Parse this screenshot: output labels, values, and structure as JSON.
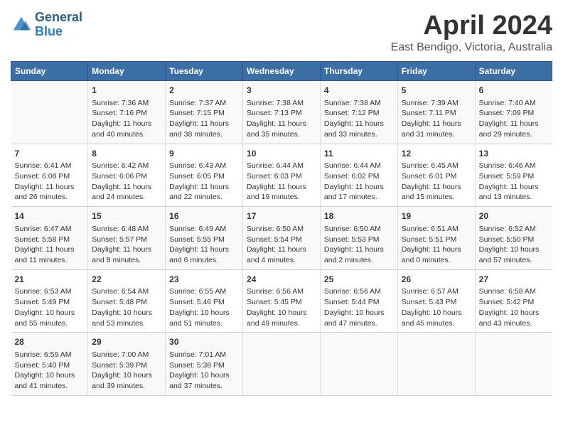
{
  "header": {
    "logo_line1": "General",
    "logo_line2": "Blue",
    "title": "April 2024",
    "subtitle": "East Bendigo, Victoria, Australia"
  },
  "columns": [
    "Sunday",
    "Monday",
    "Tuesday",
    "Wednesday",
    "Thursday",
    "Friday",
    "Saturday"
  ],
  "weeks": [
    {
      "cells": [
        {
          "day": "",
          "info": ""
        },
        {
          "day": "1",
          "info": "Sunrise: 7:36 AM\nSunset: 7:16 PM\nDaylight: 11 hours\nand 40 minutes."
        },
        {
          "day": "2",
          "info": "Sunrise: 7:37 AM\nSunset: 7:15 PM\nDaylight: 11 hours\nand 38 minutes."
        },
        {
          "day": "3",
          "info": "Sunrise: 7:38 AM\nSunset: 7:13 PM\nDaylight: 11 hours\nand 35 minutes."
        },
        {
          "day": "4",
          "info": "Sunrise: 7:38 AM\nSunset: 7:12 PM\nDaylight: 11 hours\nand 33 minutes."
        },
        {
          "day": "5",
          "info": "Sunrise: 7:39 AM\nSunset: 7:11 PM\nDaylight: 11 hours\nand 31 minutes."
        },
        {
          "day": "6",
          "info": "Sunrise: 7:40 AM\nSunset: 7:09 PM\nDaylight: 11 hours\nand 29 minutes."
        }
      ]
    },
    {
      "cells": [
        {
          "day": "7",
          "info": "Sunrise: 6:41 AM\nSunset: 6:08 PM\nDaylight: 11 hours\nand 26 minutes."
        },
        {
          "day": "8",
          "info": "Sunrise: 6:42 AM\nSunset: 6:06 PM\nDaylight: 11 hours\nand 24 minutes."
        },
        {
          "day": "9",
          "info": "Sunrise: 6:43 AM\nSunset: 6:05 PM\nDaylight: 11 hours\nand 22 minutes."
        },
        {
          "day": "10",
          "info": "Sunrise: 6:44 AM\nSunset: 6:03 PM\nDaylight: 11 hours\nand 19 minutes."
        },
        {
          "day": "11",
          "info": "Sunrise: 6:44 AM\nSunset: 6:02 PM\nDaylight: 11 hours\nand 17 minutes."
        },
        {
          "day": "12",
          "info": "Sunrise: 6:45 AM\nSunset: 6:01 PM\nDaylight: 11 hours\nand 15 minutes."
        },
        {
          "day": "13",
          "info": "Sunrise: 6:46 AM\nSunset: 5:59 PM\nDaylight: 11 hours\nand 13 minutes."
        }
      ]
    },
    {
      "cells": [
        {
          "day": "14",
          "info": "Sunrise: 6:47 AM\nSunset: 5:58 PM\nDaylight: 11 hours\nand 11 minutes."
        },
        {
          "day": "15",
          "info": "Sunrise: 6:48 AM\nSunset: 5:57 PM\nDaylight: 11 hours\nand 8 minutes."
        },
        {
          "day": "16",
          "info": "Sunrise: 6:49 AM\nSunset: 5:55 PM\nDaylight: 11 hours\nand 6 minutes."
        },
        {
          "day": "17",
          "info": "Sunrise: 6:50 AM\nSunset: 5:54 PM\nDaylight: 11 hours\nand 4 minutes."
        },
        {
          "day": "18",
          "info": "Sunrise: 6:50 AM\nSunset: 5:53 PM\nDaylight: 11 hours\nand 2 minutes."
        },
        {
          "day": "19",
          "info": "Sunrise: 6:51 AM\nSunset: 5:51 PM\nDaylight: 11 hours\nand 0 minutes."
        },
        {
          "day": "20",
          "info": "Sunrise: 6:52 AM\nSunset: 5:50 PM\nDaylight: 10 hours\nand 57 minutes."
        }
      ]
    },
    {
      "cells": [
        {
          "day": "21",
          "info": "Sunrise: 6:53 AM\nSunset: 5:49 PM\nDaylight: 10 hours\nand 55 minutes."
        },
        {
          "day": "22",
          "info": "Sunrise: 6:54 AM\nSunset: 5:48 PM\nDaylight: 10 hours\nand 53 minutes."
        },
        {
          "day": "23",
          "info": "Sunrise: 6:55 AM\nSunset: 5:46 PM\nDaylight: 10 hours\nand 51 minutes."
        },
        {
          "day": "24",
          "info": "Sunrise: 6:56 AM\nSunset: 5:45 PM\nDaylight: 10 hours\nand 49 minutes."
        },
        {
          "day": "25",
          "info": "Sunrise: 6:56 AM\nSunset: 5:44 PM\nDaylight: 10 hours\nand 47 minutes."
        },
        {
          "day": "26",
          "info": "Sunrise: 6:57 AM\nSunset: 5:43 PM\nDaylight: 10 hours\nand 45 minutes."
        },
        {
          "day": "27",
          "info": "Sunrise: 6:58 AM\nSunset: 5:42 PM\nDaylight: 10 hours\nand 43 minutes."
        }
      ]
    },
    {
      "cells": [
        {
          "day": "28",
          "info": "Sunrise: 6:59 AM\nSunset: 5:40 PM\nDaylight: 10 hours\nand 41 minutes."
        },
        {
          "day": "29",
          "info": "Sunrise: 7:00 AM\nSunset: 5:39 PM\nDaylight: 10 hours\nand 39 minutes."
        },
        {
          "day": "30",
          "info": "Sunrise: 7:01 AM\nSunset: 5:38 PM\nDaylight: 10 hours\nand 37 minutes."
        },
        {
          "day": "",
          "info": ""
        },
        {
          "day": "",
          "info": ""
        },
        {
          "day": "",
          "info": ""
        },
        {
          "day": "",
          "info": ""
        }
      ]
    }
  ]
}
